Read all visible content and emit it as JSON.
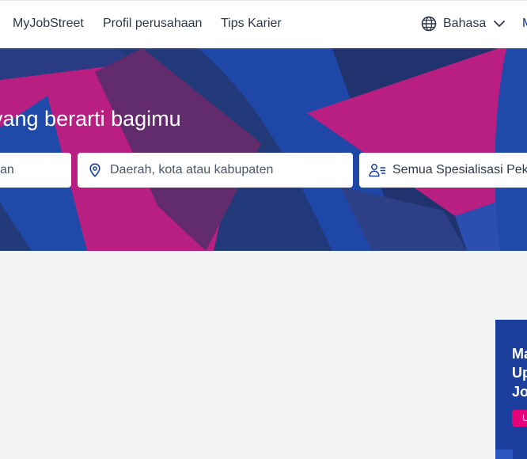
{
  "nav": {
    "items": [
      {
        "label": "MyJobStreet"
      },
      {
        "label": "Profil perusahaan"
      },
      {
        "label": "Tips Karier"
      }
    ],
    "language_label": "Bahasa",
    "cut_item": "M"
  },
  "hero": {
    "title": "yang berarti bagimu",
    "keyword_field_visible_text": "an",
    "location_placeholder": "Daerah, kota atau kabupaten",
    "classification_label": "Semua Spesialisasi Pek"
  },
  "promo": {
    "lines": [
      "Ma",
      "Up",
      "Jo"
    ],
    "button_label": "U"
  },
  "colors": {
    "hero_blue": "#1e47a8",
    "hero_navy": "#233a7a",
    "hero_magenta": "#b81f80",
    "accent_pink": "#e60278",
    "page_bg": "#f3f4f6"
  }
}
